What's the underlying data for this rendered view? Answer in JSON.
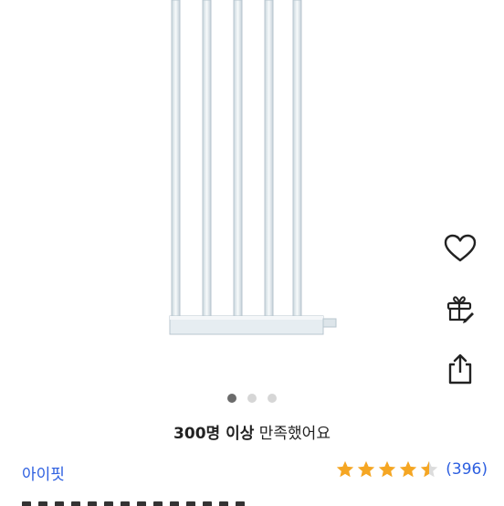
{
  "gallery": {
    "image_alt": "white baby safety gate extension panel",
    "pages": 3,
    "active_page": 1
  },
  "side_actions": [
    "heart-icon",
    "gift-icon",
    "share-icon"
  ],
  "satisfaction": {
    "bold": "300명 이상",
    "rest": " 만족했어요"
  },
  "brand": "아이핏",
  "rating": {
    "stars": 4.5,
    "star_color": "#f5a623",
    "count": "(396)"
  },
  "colors": {
    "link": "#2d5fe0",
    "dot_active": "#6b6b6b",
    "dot_inactive": "#d6d6d6"
  }
}
